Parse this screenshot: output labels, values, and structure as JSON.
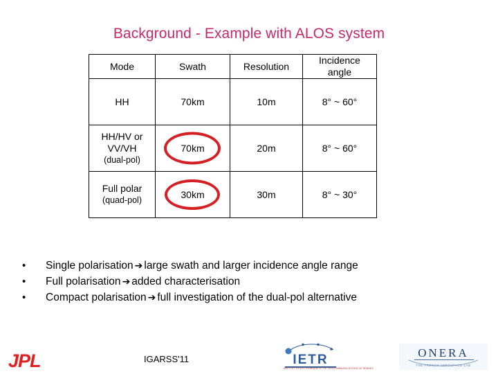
{
  "slide": {
    "title": "Background - Example with ALOS system",
    "title_color": "#C5286B",
    "highlight_color": "#D41F25"
  },
  "table": {
    "headers": {
      "mode": "Mode",
      "swath": "Swath",
      "resolution": "Resolution",
      "incidence_line1": "Incidence",
      "incidence_line2": "angle"
    },
    "rows": [
      {
        "mode_line1": "HH",
        "mode_line2": "",
        "mode_line3": "",
        "swath": "70km",
        "swath_circled": false,
        "resolution": "10m",
        "incidence": "8° ~ 60°"
      },
      {
        "mode_line1": "HH/HV or",
        "mode_line2": "VV/VH",
        "mode_line3": "(dual-pol)",
        "swath": "70km",
        "swath_circled": true,
        "resolution": "20m",
        "incidence": "8° ~ 60°"
      },
      {
        "mode_line1": "Full polar",
        "mode_line2": "",
        "mode_line3": "(quad-pol)",
        "swath": "30km",
        "swath_circled": true,
        "resolution": "30m",
        "incidence": "8° ~ 30°"
      }
    ]
  },
  "bullets": [
    {
      "marker": "•",
      "before": "Single polarisation",
      "arrow": "➔",
      "after": "large swath and larger incidence angle range"
    },
    {
      "marker": "•",
      "before": "Full polarisation",
      "arrow": "➔",
      "after": "added characterisation"
    },
    {
      "marker": "•",
      "before": "Compact polarisation",
      "arrow": "➔",
      "after": "full investigation of the dual-pol alternative"
    }
  ],
  "footer": {
    "jpl_logo_text": "JPL",
    "conference": "IGARSS'11",
    "ietr_logo_text": "IETR",
    "ietr_tagline": "INSTITUT D'ELECTRONIQUE ET DE TELECOMMUNICATIONS DE RENNES",
    "onera_logo_text": "ONERA",
    "onera_tagline": "THE FRENCH AEROSPACE LAB"
  }
}
